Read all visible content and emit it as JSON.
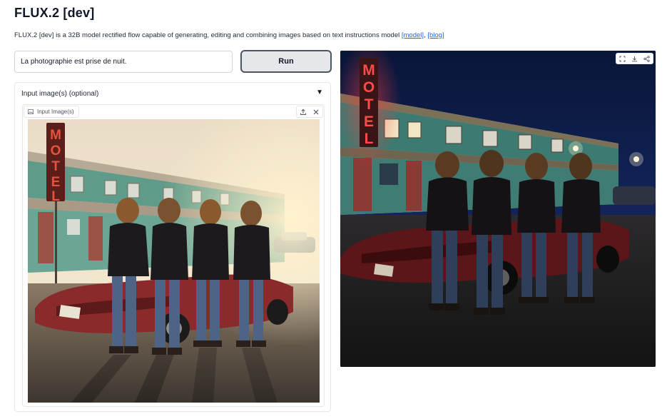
{
  "header": {
    "title": "FLUX.2 [dev]",
    "description": "FLUX.2 [dev] is a 32B model rectified flow capable of generating, editing and combining images based on text instructions model ",
    "link_model": "[model]",
    "separator": ", ",
    "link_blog": "[blog]"
  },
  "prompt": {
    "value": "La photographie est prise de nuit."
  },
  "run_button": {
    "label": "Run"
  },
  "accordion": {
    "label": "Input image(s) (optional)",
    "arrow": "▼"
  },
  "input_gallery": {
    "label": "Input Image(s)",
    "sign_text": "MOTEL"
  },
  "output_image": {
    "sign_text": "MOTEL"
  },
  "colors": {
    "accent_link": "#2563eb",
    "button_bg": "#e5e7eb",
    "button_border": "#4b5563",
    "neon_red": "#ff3b3b"
  }
}
